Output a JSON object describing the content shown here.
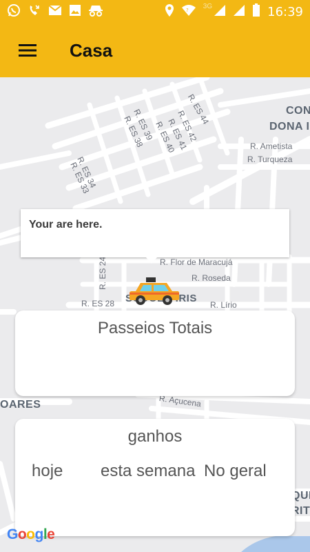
{
  "status_bar": {
    "time": "16:39",
    "network": "3G",
    "icons": [
      "whatsapp-icon",
      "missed-call-icon",
      "mail-icon",
      "image-icon",
      "incognito-icon",
      "location-icon",
      "wifi-icon",
      "signal-icon",
      "battery-icon"
    ]
  },
  "app_bar": {
    "title": "Casa",
    "menu_icon": "hamburger-menu-icon",
    "color": "#f3b814"
  },
  "map": {
    "streets": [
      "R. ES 44",
      "R. ES 42",
      "R. ES 41",
      "R. ES 40",
      "R. ES 39",
      "R. ES 38",
      "R. ES 34",
      "R. ES 33",
      "R. Ametista",
      "R. Turqueza",
      "R. Flor de Maracujá",
      "R. Roseda",
      "R. ES 24",
      "R. ES 28",
      "R. Lírio",
      "R. Açucena"
    ],
    "areas": [
      "CON",
      "DONA I",
      "SODOLO IRIS",
      "OARES",
      "QUE",
      "RIT"
    ],
    "info_window": "Your are here.",
    "attribution": "Google"
  },
  "cards": {
    "total_rides_title": "Passeios Totais",
    "earnings": {
      "title": "ganhos",
      "today": "hoje",
      "this_week": "esta semana",
      "overall": "No geral"
    }
  }
}
